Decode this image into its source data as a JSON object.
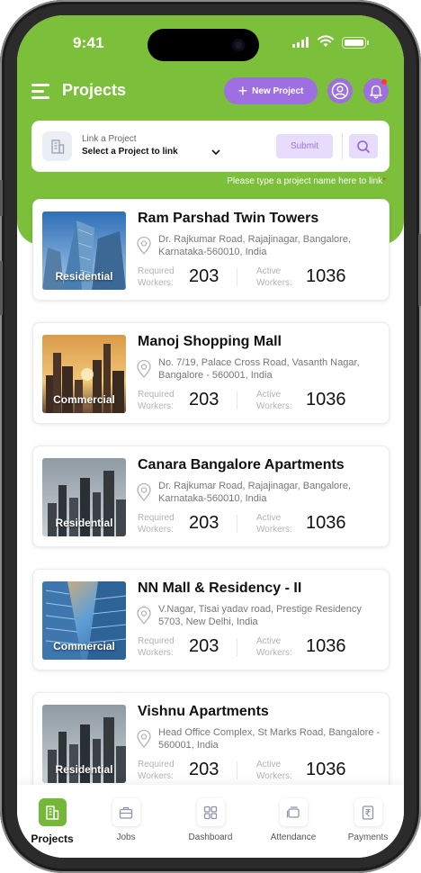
{
  "status": {
    "time": "9:41"
  },
  "header": {
    "title": "Projects",
    "new_project_label": "New Project"
  },
  "link_project": {
    "label": "Link a Project",
    "select_value": "Select a Project to link",
    "submit_label": "Submit",
    "hint": "Please type a project name here to link",
    "hint_marker": "*"
  },
  "metric_labels": {
    "required": "Required Workers:",
    "active": "Active Workers:"
  },
  "projects": [
    {
      "name": "Ram Parshad Twin Towers",
      "address": "Dr. Rajkumar Road, Rajajinagar, Bangalore, Karnataka-560010, India",
      "type": "Residential",
      "required_workers": "203",
      "active_workers": "1036"
    },
    {
      "name": "Manoj Shopping Mall",
      "address": "No. 7/19, Palace Cross Road, Vasanth Nagar, Bangalore - 560001, India",
      "type": "Commercial",
      "required_workers": "203",
      "active_workers": "1036"
    },
    {
      "name": "Canara Bangalore Apartments",
      "address": "Dr. Rajkumar Road, Rajajinagar, Bangalore, Karnataka-560010, India",
      "type": "Residential",
      "required_workers": "203",
      "active_workers": "1036"
    },
    {
      "name": "NN Mall & Residency - II",
      "address": "V.Nagar, Tisai yadav road, Prestige Residency 5703, New Delhi, India",
      "type": "Commercial",
      "required_workers": "203",
      "active_workers": "1036"
    },
    {
      "name": "Vishnu Apartments",
      "address": "Head Office Complex, St Marks Road, Bangalore - 560001, India",
      "type": "Residential",
      "required_workers": "203",
      "active_workers": "1036"
    }
  ],
  "bottom_nav": [
    {
      "label": "Projects",
      "icon": "building-icon",
      "active": true
    },
    {
      "label": "Jobs",
      "icon": "briefcase-icon",
      "active": false
    },
    {
      "label": "Dashboard",
      "icon": "grid-icon",
      "active": false
    },
    {
      "label": "Attendance",
      "icon": "cards-icon",
      "active": false
    },
    {
      "label": "Payments",
      "icon": "rupee-doc-icon",
      "active": false
    }
  ],
  "colors": {
    "accent_green": "#7cbf3a",
    "accent_purple": "#9d6fe0",
    "light_purple": "#e7dcfb"
  }
}
